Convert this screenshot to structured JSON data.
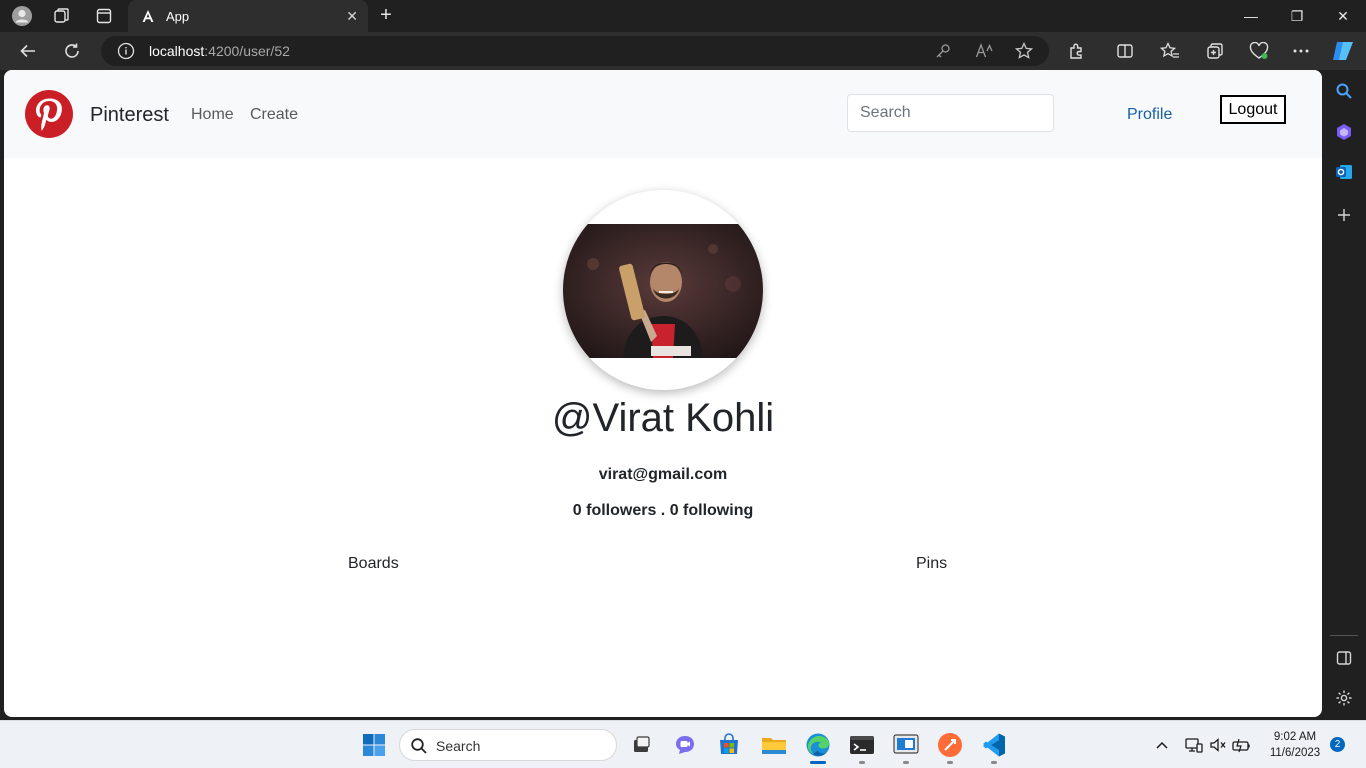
{
  "browser": {
    "tab_title": "App",
    "url_host": "localhost",
    "url_path": ":4200/user/52",
    "close_tab_glyph": "✕",
    "new_tab_glyph": "+",
    "window_controls": [
      "—",
      "❐",
      "✕"
    ]
  },
  "header": {
    "brand": "Pinterest",
    "nav": {
      "home": "Home",
      "create": "Create"
    },
    "search_placeholder": "Search",
    "profile_link": "Profile",
    "logout_label": "Logout"
  },
  "profile": {
    "username": "@Virat Kohli",
    "email": "virat@gmail.com",
    "followers": "0 followers",
    "separator": " . ",
    "following": "0 following"
  },
  "tabs": {
    "boards": "Boards",
    "pins": "Pins"
  },
  "taskbar": {
    "search_label": "Search",
    "time": "9:02 AM",
    "date": "11/6/2023",
    "notification_count": "2"
  },
  "colors": {
    "pinterest_red": "#cb1f27",
    "profile_link": "#1a5ea8",
    "taskbar_accent": "#0067c0"
  }
}
